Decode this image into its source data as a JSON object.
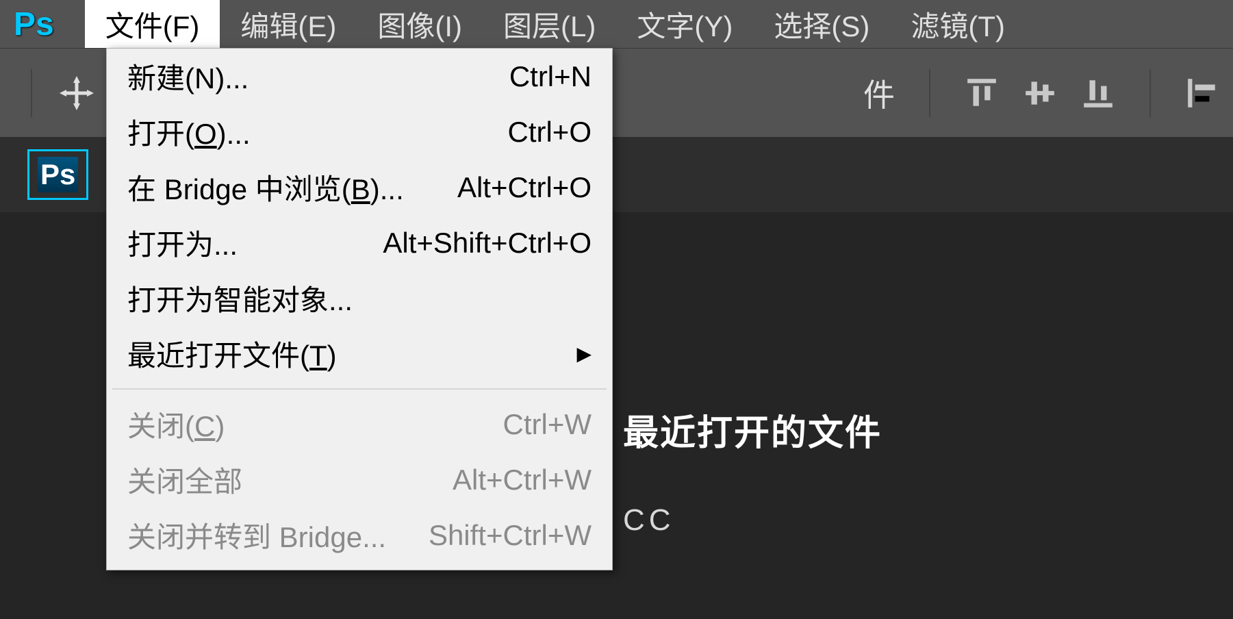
{
  "app": {
    "logo": "Ps"
  },
  "menubar": [
    {
      "label": "文件(F)",
      "active": true
    },
    {
      "label": "编辑(E)",
      "active": false
    },
    {
      "label": "图像(I)",
      "active": false
    },
    {
      "label": "图层(L)",
      "active": false
    },
    {
      "label": "文字(Y)",
      "active": false
    },
    {
      "label": "选择(S)",
      "active": false
    },
    {
      "label": "滤镜(T)",
      "active": false
    }
  ],
  "toolbar": {
    "partial_text": "件"
  },
  "tab": {
    "label": "Ps"
  },
  "dropdown": {
    "items": [
      {
        "label": "新建(N)...",
        "shortcut": "Ctrl+N",
        "enabled": true
      },
      {
        "label": "打开(O)...",
        "shortcut": "Ctrl+O",
        "enabled": true,
        "highlighted": true
      },
      {
        "label": "在 Bridge 中浏览(B)...",
        "shortcut": "Alt+Ctrl+O",
        "enabled": true
      },
      {
        "label": "打开为...",
        "shortcut": "Alt+Shift+Ctrl+O",
        "enabled": true
      },
      {
        "label": "打开为智能对象...",
        "shortcut": "",
        "enabled": true
      },
      {
        "label": "最近打开文件(T)",
        "shortcut": "",
        "enabled": true,
        "submenu": true
      },
      {
        "separator": true
      },
      {
        "label": "关闭(C)",
        "shortcut": "Ctrl+W",
        "enabled": false
      },
      {
        "label": "关闭全部",
        "shortcut": "Alt+Ctrl+W",
        "enabled": false
      },
      {
        "label": "关闭并转到 Bridge...",
        "shortcut": "Shift+Ctrl+W",
        "enabled": false
      }
    ]
  },
  "workspace": {
    "recent_title": "最近打开的文件",
    "recent_sub": "CC"
  }
}
